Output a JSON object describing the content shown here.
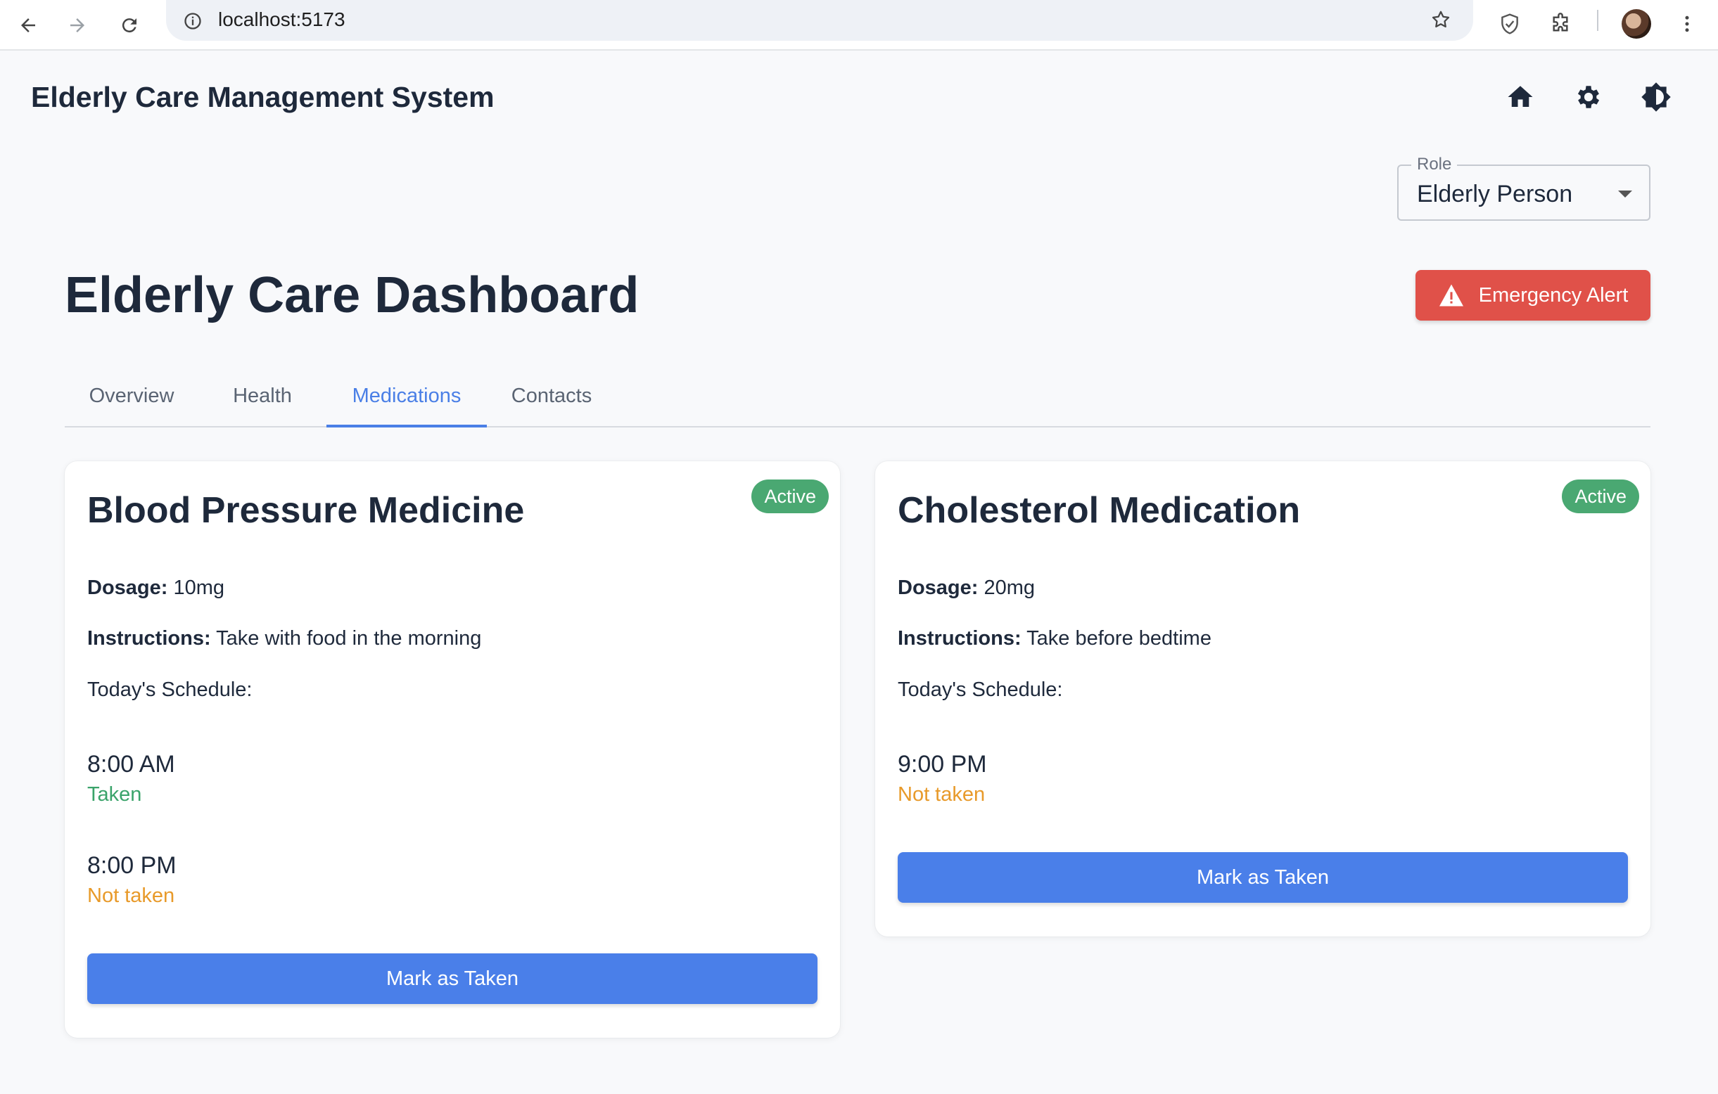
{
  "browser": {
    "url": "localhost:5173"
  },
  "header": {
    "app_title": "Elderly Care Management System",
    "icons": [
      "home-icon",
      "gear-icon",
      "brightness-icon"
    ]
  },
  "role": {
    "label": "Role",
    "selected": "Elderly Person"
  },
  "page": {
    "title": "Elderly Care Dashboard",
    "emergency_label": "Emergency Alert"
  },
  "tabs": [
    {
      "label": "Overview",
      "active": false
    },
    {
      "label": "Health",
      "active": false
    },
    {
      "label": "Medications",
      "active": true
    },
    {
      "label": "Contacts",
      "active": false
    }
  ],
  "medications": [
    {
      "name": "Blood Pressure Medicine",
      "status": "Active",
      "dosage_label": "Dosage:",
      "dosage": "10mg",
      "instructions_label": "Instructions:",
      "instructions": "Take with food in the morning",
      "schedule_label": "Today's Schedule:",
      "schedule": [
        {
          "time": "8:00 AM",
          "status": "Taken"
        },
        {
          "time": "8:00 PM",
          "status": "Not taken"
        }
      ],
      "button": "Mark as Taken"
    },
    {
      "name": "Cholesterol Medication",
      "status": "Active",
      "dosage_label": "Dosage:",
      "dosage": "20mg",
      "instructions_label": "Instructions:",
      "instructions": "Take before bedtime",
      "schedule_label": "Today's Schedule:",
      "schedule": [
        {
          "time": "9:00 PM",
          "status": "Not taken"
        }
      ],
      "button": "Mark as Taken"
    }
  ],
  "colors": {
    "accent": "#4a7fe6",
    "danger": "#e05149",
    "success": "#3aa36a",
    "warning": "#e89a2a",
    "badge": "#4aa872"
  }
}
